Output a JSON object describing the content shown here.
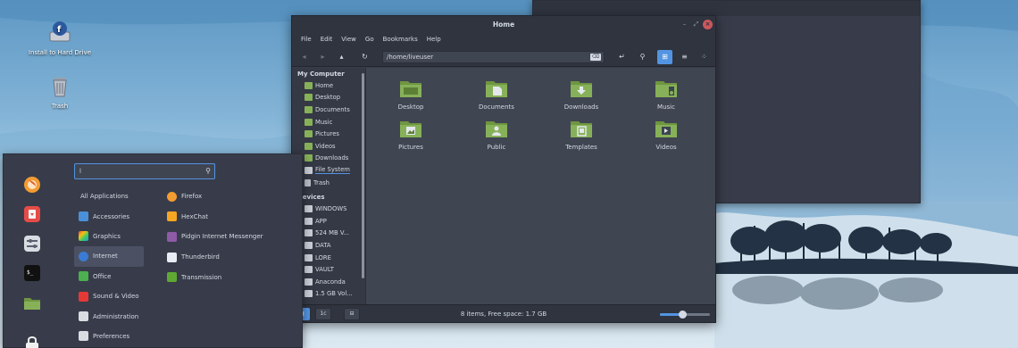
{
  "desktop": {
    "icons": [
      {
        "label": "Install to Hard Drive",
        "icon": "fedora-install-icon"
      },
      {
        "label": "Trash",
        "icon": "trash-icon"
      }
    ]
  },
  "file_manager": {
    "title": "Home",
    "menu": [
      "File",
      "Edit",
      "View",
      "Go",
      "Bookmarks",
      "Help"
    ],
    "location": "/home/liveuser",
    "sidebar": {
      "my_computer_heading": "My Computer",
      "places": [
        "Home",
        "Desktop",
        "Documents",
        "Music",
        "Pictures",
        "Videos",
        "Downloads",
        "File System",
        "Trash"
      ],
      "devices_heading": "Devices",
      "devices": [
        "WINDOWS",
        "APP",
        "524 MB V...",
        "DATA",
        "LORE",
        "VAULT",
        "Anaconda",
        "1.5 GB Vol..."
      ]
    },
    "files": [
      "Desktop",
      "Documents",
      "Downloads",
      "Music",
      "Pictures",
      "Public",
      "Templates",
      "Videos"
    ],
    "status": "8 items, Free space: 1.7 GB",
    "zoom_level": 0.45,
    "colors": {
      "folder": "#87b158",
      "accent": "#5294e2"
    }
  },
  "start_menu": {
    "search_value": "l",
    "categories": [
      "All Applications",
      "Accessories",
      "Graphics",
      "Internet",
      "Office",
      "Sound & Video",
      "Administration",
      "Preferences"
    ],
    "selected_category": "Internet",
    "apps": [
      "Firefox",
      "HexChat",
      "Pidgin Internet Messenger",
      "Thunderbird",
      "Transmission"
    ],
    "favorites": [
      "firefox-icon",
      "software-icon",
      "settings-icon",
      "terminal-icon",
      "files-icon",
      "lock-icon"
    ]
  }
}
